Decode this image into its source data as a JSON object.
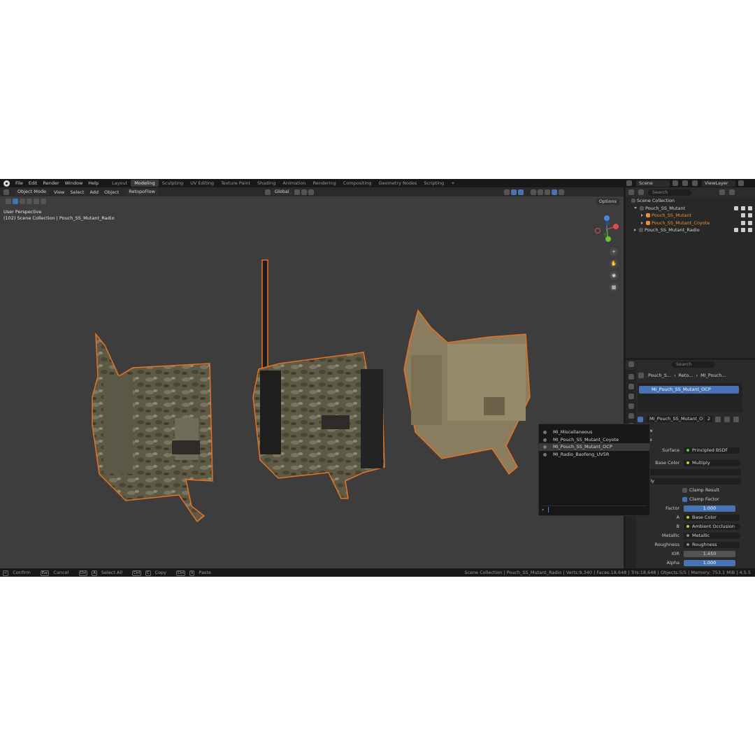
{
  "topbar": {
    "menus": [
      "File",
      "Edit",
      "Render",
      "Window",
      "Help"
    ],
    "workspaces": [
      "Layout",
      "Modeling",
      "Sculpting",
      "UV Editing",
      "Texture Paint",
      "Shading",
      "Animation",
      "Rendering",
      "Compositing",
      "Geometry Nodes",
      "Scripting",
      "+"
    ],
    "active_workspace": "Modeling",
    "scene": "Scene",
    "view_layer": "ViewLayer"
  },
  "viewport": {
    "mode": "Object Mode",
    "menus": [
      "View",
      "Select",
      "Add",
      "Object",
      "RetopoFlow"
    ],
    "orientation": "Global",
    "options_label": "Options",
    "perspective_label": "User Perspective",
    "collection_info": "(102) Scene Collection | Pouch_SS_Mutant_Radio"
  },
  "outliner": {
    "search_placeholder": "Search",
    "root": "Scene Collection",
    "items": [
      {
        "name": "Pouch_SS_Mutant",
        "level": 1,
        "expanded": true,
        "selected": false
      },
      {
        "name": "Pouch_SS_Mutant",
        "level": 2,
        "expanded": false,
        "selected": true
      },
      {
        "name": "Pouch_SS_Mutant_Coyote",
        "level": 2,
        "expanded": false,
        "selected": true
      },
      {
        "name": "Pouch_SS_Mutant_Radio",
        "level": 1,
        "expanded": false,
        "selected": false
      }
    ]
  },
  "properties": {
    "search_placeholder": "Search",
    "breadcrumb": [
      "Pouch_S...",
      "Reto...",
      "MI_Pouch..."
    ],
    "material_slot": "MI_Pouch_SS_Mutant_OCP",
    "material_name": "MI_Pouch_SS_Mutant_O...",
    "material_users": "2",
    "preview_label": "review",
    "surface_section": "urface",
    "surface_label": "Surface",
    "surface_value": "Principled BSDF",
    "base_color_label": "Base Color",
    "base_color_value": "Multiply",
    "dropdown1": "lor",
    "dropdown2": "ultiply",
    "clamp_result": "Clamp Result",
    "clamp_factor": "Clamp Factor",
    "factor_label": "Factor",
    "factor_value": "1.000",
    "a_label": "A",
    "a_value": "Base Color",
    "b_label": "B",
    "b_value": "Ambient Occlusion",
    "metallic_label": "Metallic",
    "metallic_value": "Metallic",
    "roughness_label": "Roughness",
    "roughness_value": "Roughness",
    "ior_label": "IOR",
    "ior_value": "1.450",
    "alpha_label": "Alpha",
    "alpha_value": "1.000"
  },
  "material_popup": {
    "items": [
      "MI_Miscellaneous",
      "MI_Pouch_SS_Mutant_Coyote",
      "MI_Pouch_SS_Mutant_OCP",
      "MI_Radio_Baofeng_UV5R"
    ],
    "highlighted": "MI_Pouch_SS_Mutant_OCP"
  },
  "statusbar": {
    "confirm": "Confirm",
    "cancel": "Cancel",
    "select_all": "Select All",
    "copy": "Copy",
    "paste": "Paste",
    "stats": "Scene Collection | Pouch_SS_Mutant_Radio | Verts:9,340 | Faces:18,648 | Tris:18,648 | Objects:5/5 | Memory: 753.1 MiB | 4.5.5"
  },
  "colors": {
    "outline": "#e8721f",
    "accent": "#4772b3",
    "viewport_bg": "#3e3d3e"
  }
}
